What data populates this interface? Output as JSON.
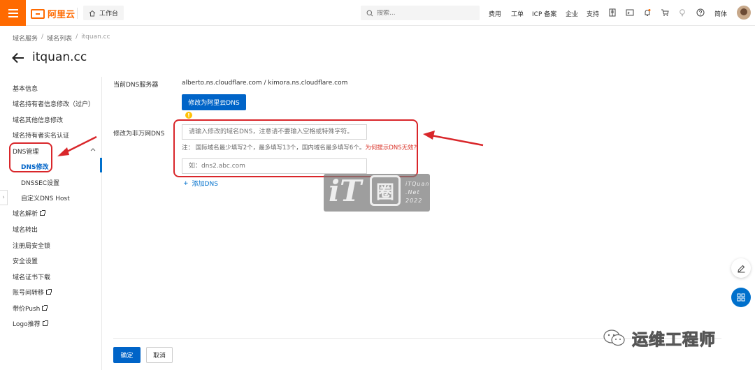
{
  "topbar": {
    "brand": "阿里云",
    "workbench": "工作台",
    "search_placeholder": "搜索...",
    "nav": [
      "费用",
      "工单",
      "ICP 备案",
      "企业",
      "支持"
    ],
    "lang": "简体",
    "accent": "#ff6a00"
  },
  "breadcrumb": [
    "域名服务",
    "域名列表",
    "itquan.cc"
  ],
  "page_title": "itquan.cc",
  "sidebar": {
    "items": [
      {
        "label": "基本信息"
      },
      {
        "label": "域名持有者信息修改（过户）"
      },
      {
        "label": "域名其他信息修改"
      },
      {
        "label": "域名持有者实名认证"
      },
      {
        "label": "DNS管理"
      },
      {
        "label": "DNS修改"
      },
      {
        "label": "DNSSEC设置"
      },
      {
        "label": "自定义DNS Host"
      },
      {
        "label": "域名解析"
      },
      {
        "label": "域名转出"
      },
      {
        "label": "注册局安全锁"
      },
      {
        "label": "安全设置"
      },
      {
        "label": "域名证书下载"
      },
      {
        "label": "账号间转移"
      },
      {
        "label": "带价Push"
      },
      {
        "label": "Logo推荐"
      }
    ]
  },
  "form": {
    "current_dns_label": "当前DNS服务器",
    "current_dns_value": "alberto.ns.cloudflare.com / kimora.ns.cloudflare.com",
    "switch_button": "修改为阿里云DNS",
    "non_wanwang_label": "修改为非万网DNS",
    "dns1_placeholder": "请输入修改的域名DNS，注意请不要输入空格或特殊字符。",
    "note_prefix": "注：  国际域名最少填写2个，最多填写13个，国内域名最多填写6个。",
    "note_link": "为何提示DNS无效?",
    "dns2_placeholder": "如：dns2.abc.com",
    "add_dns": "添加DNS"
  },
  "footer": {
    "confirm": "确定",
    "cancel": "取消"
  },
  "watermark": {
    "logo_it": "iT",
    "logo_quan": "圈",
    "line1": "iTQuan",
    "line2": ".Net",
    "line3": "2022",
    "wechat": "运维工程师"
  },
  "colors": {
    "primary": "#0064c8",
    "link_red": "#d93026",
    "annotation": "#d9262a"
  }
}
